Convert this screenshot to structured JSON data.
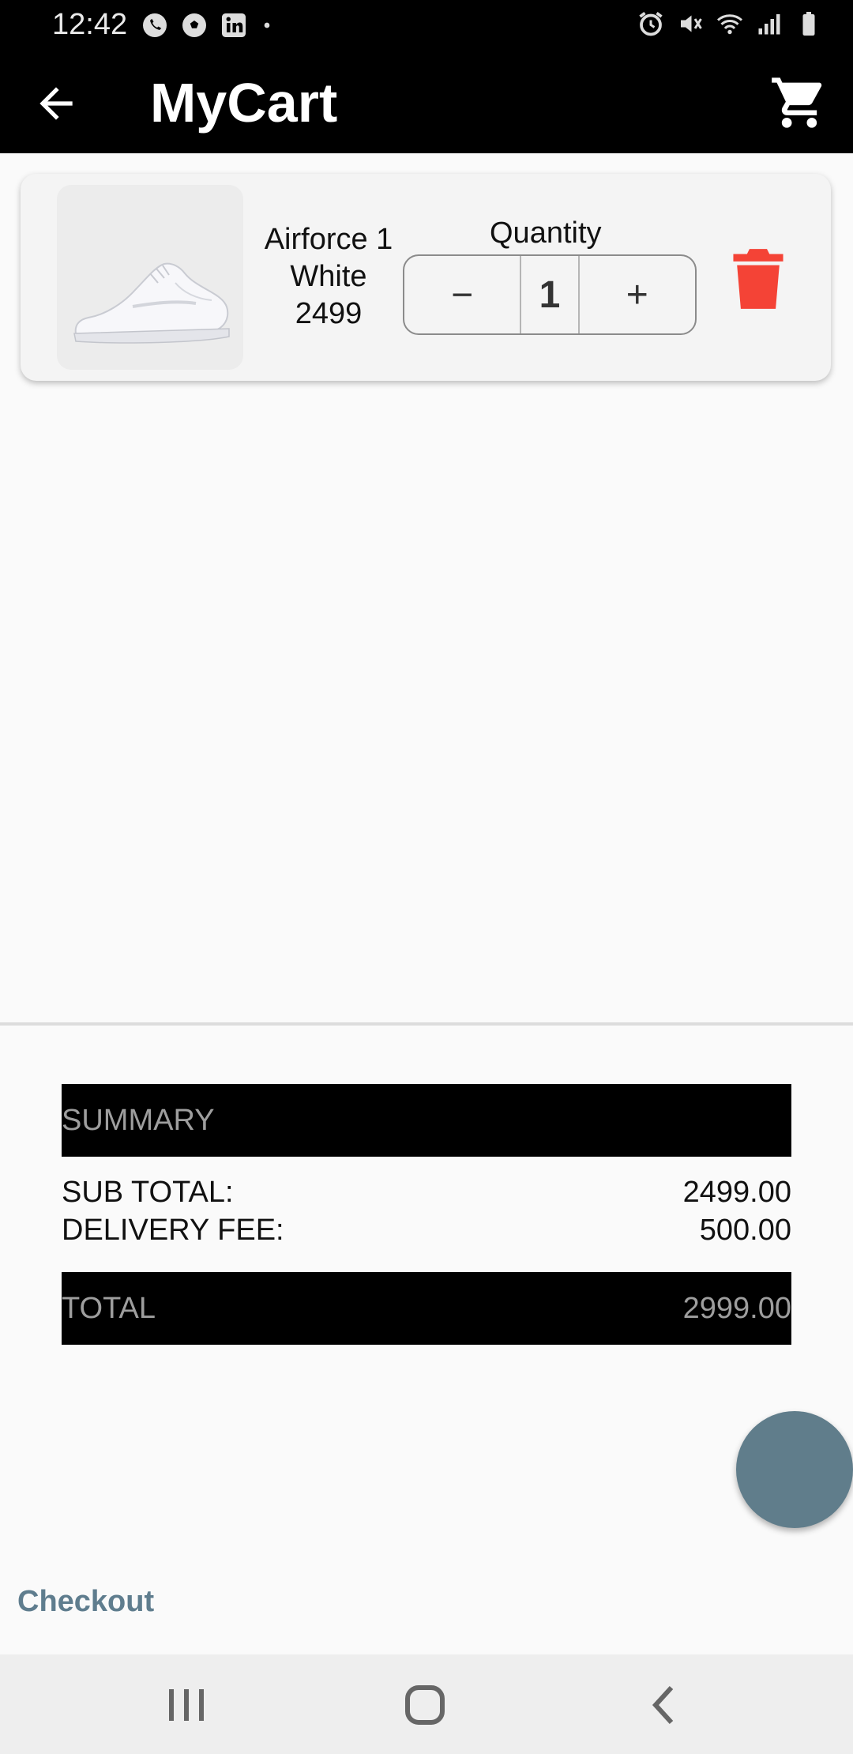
{
  "status_bar": {
    "time": "12:42"
  },
  "app_bar": {
    "title": "MyCart"
  },
  "cart_items": [
    {
      "name": "Airforce 1",
      "color": "White",
      "price": "2499",
      "quantity_label": "Quantity",
      "quantity": "1",
      "minus_label": "−",
      "plus_label": "+"
    }
  ],
  "summary": {
    "header": "SUMMARY",
    "subtotal_label": "SUB TOTAL:",
    "subtotal_value": "2499.00",
    "delivery_label": "DELIVERY FEE:",
    "delivery_value": "500.00",
    "total_label": "TOTAL",
    "total_value": "2999.00"
  },
  "actions": {
    "checkout_label": "Checkout"
  },
  "colors": {
    "accent": "#607d8b",
    "delete": "#f44336",
    "bar_background": "#000000",
    "bar_text": "#9e9e9e"
  },
  "icons": {
    "back": "arrow-left-icon",
    "cart": "shopping-cart-icon",
    "delete": "trash-icon",
    "status_left": [
      "whatsapp-icon",
      "soccer-ball-icon",
      "linkedin-icon",
      "dot-icon"
    ],
    "status_right": [
      "alarm-icon",
      "mute-icon",
      "wifi-icon",
      "signal-icon",
      "battery-icon"
    ],
    "nav": [
      "recent-apps-icon",
      "home-icon",
      "back-nav-icon"
    ]
  }
}
